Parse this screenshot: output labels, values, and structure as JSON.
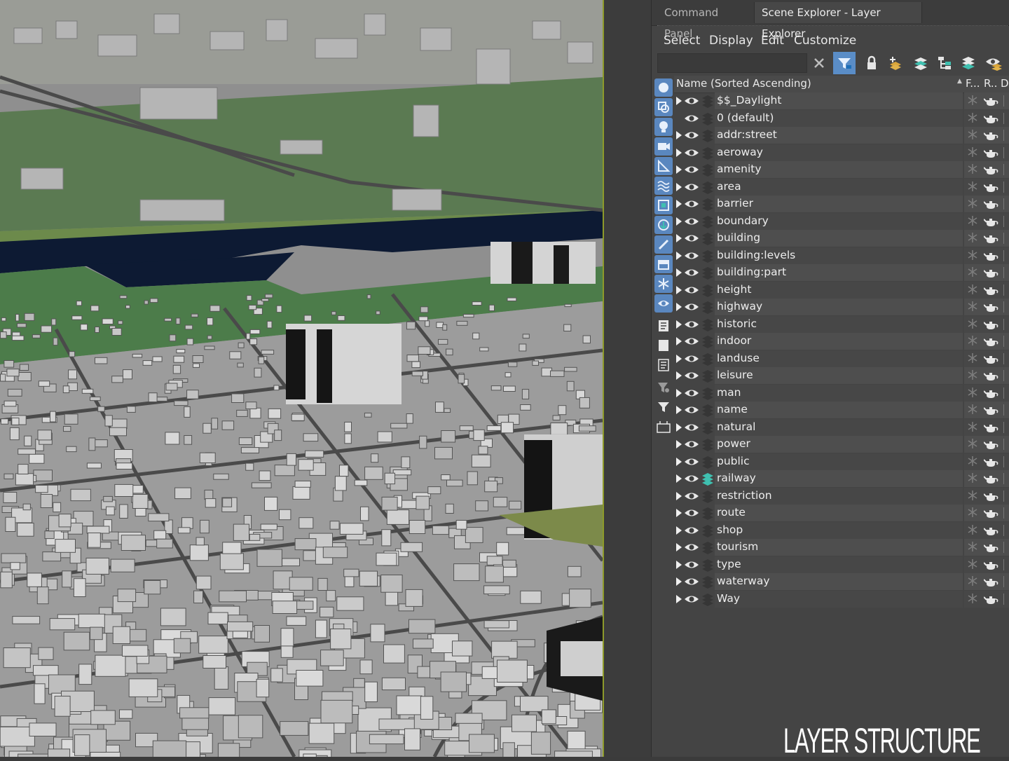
{
  "tabs": {
    "command_panel": "Command Panel",
    "scene_explorer": "Scene Explorer - Layer Explorer"
  },
  "menu": {
    "select": "Select",
    "display": "Display",
    "edit": "Edit",
    "customize": "Customize"
  },
  "search": {
    "value": ""
  },
  "columns": {
    "name": "Name (Sorted Ascending)",
    "sort_indicator": "▲",
    "frozen": "F...",
    "renderable": "R..",
    "display": "D"
  },
  "layers": [
    {
      "name": "$$_Daylight",
      "expandable": true
    },
    {
      "name": "0 (default)",
      "expandable": false
    },
    {
      "name": "addr:street",
      "expandable": true
    },
    {
      "name": "aeroway",
      "expandable": true
    },
    {
      "name": "amenity",
      "expandable": true
    },
    {
      "name": "area",
      "expandable": true
    },
    {
      "name": "barrier",
      "expandable": true
    },
    {
      "name": "boundary",
      "expandable": true
    },
    {
      "name": "building",
      "expandable": true
    },
    {
      "name": "building:levels",
      "expandable": true
    },
    {
      "name": "building:part",
      "expandable": true
    },
    {
      "name": "height",
      "expandable": true
    },
    {
      "name": "highway",
      "expandable": true
    },
    {
      "name": "historic",
      "expandable": true
    },
    {
      "name": "indoor",
      "expandable": true
    },
    {
      "name": "landuse",
      "expandable": true
    },
    {
      "name": "leisure",
      "expandable": true
    },
    {
      "name": "man",
      "expandable": true
    },
    {
      "name": "name",
      "expandable": true
    },
    {
      "name": "natural",
      "expandable": true
    },
    {
      "name": "power",
      "expandable": true
    },
    {
      "name": "public",
      "expandable": true
    },
    {
      "name": "railway",
      "expandable": true,
      "active": true
    },
    {
      "name": "restriction",
      "expandable": true
    },
    {
      "name": "route",
      "expandable": true
    },
    {
      "name": "shop",
      "expandable": true
    },
    {
      "name": "tourism",
      "expandable": true
    },
    {
      "name": "type",
      "expandable": true
    },
    {
      "name": "waterway",
      "expandable": true
    },
    {
      "name": "Way",
      "expandable": true
    }
  ],
  "caption": "LAYER STRUCTURE",
  "colors": {
    "accent": "#5a8dc7",
    "active_layer": "#3fc0b0",
    "viewport_border": "#8d9a2a"
  }
}
